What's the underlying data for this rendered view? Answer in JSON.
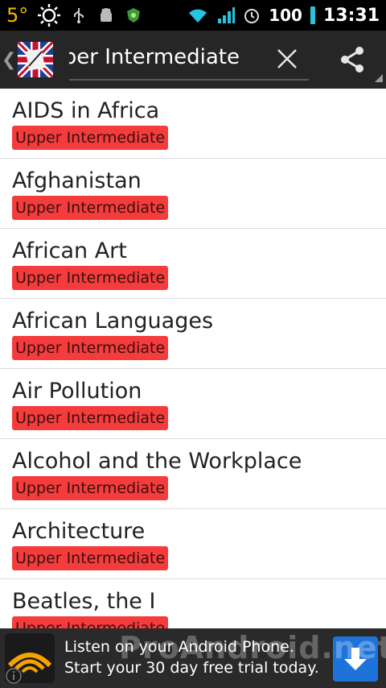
{
  "status_bar": {
    "temperature": "5°",
    "battery": "100",
    "time": "13:31",
    "icons": [
      "sun-icon",
      "usb-icon",
      "android-debug-icon",
      "security-icon",
      "wifi-icon",
      "signal-icon",
      "alarm-icon",
      "battery-icon"
    ]
  },
  "action_bar": {
    "search_text": "Upper Intermediate",
    "icons": [
      "up-chevron-icon",
      "app-logo-icon",
      "close-icon",
      "share-icon"
    ]
  },
  "list": {
    "items": [
      {
        "title": "AIDS in Africa",
        "level": "Upper Intermediate"
      },
      {
        "title": "Afghanistan",
        "level": "Upper Intermediate"
      },
      {
        "title": "African Art",
        "level": "Upper Intermediate"
      },
      {
        "title": "African Languages",
        "level": "Upper Intermediate"
      },
      {
        "title": "Air Pollution",
        "level": "Upper Intermediate"
      },
      {
        "title": "Alcohol and the Workplace",
        "level": "Upper Intermediate"
      },
      {
        "title": "Architecture",
        "level": "Upper Intermediate"
      },
      {
        "title": "Beatles, the I",
        "level": "Upper Intermediate"
      }
    ]
  },
  "ad": {
    "text": "Listen on your Android Phone. Start your 30 day free trial today.",
    "watermark": "ProAndroid.net"
  },
  "colors": {
    "badge": "#f53c3c",
    "action_bar": "#262626",
    "status_bar": "#000000",
    "ad_download": "#1e73d8"
  }
}
